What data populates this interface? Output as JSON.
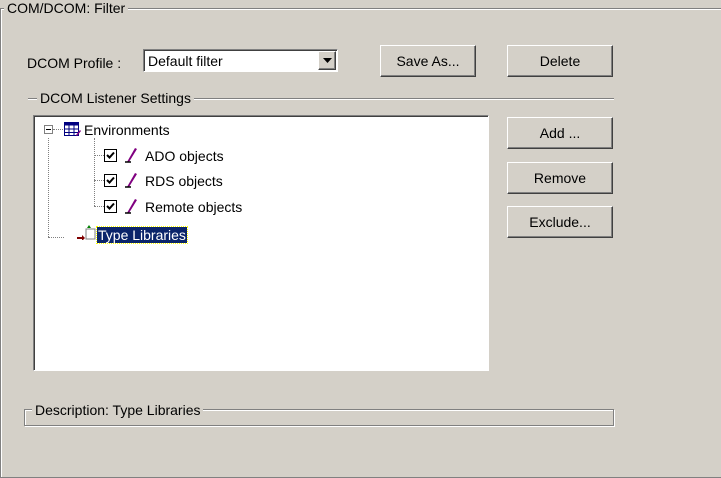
{
  "filter_group": {
    "title": "COM/DCOM: Filter"
  },
  "profile": {
    "label": "DCOM Profile :",
    "selected": "Default filter"
  },
  "buttons": {
    "save_as": "Save As...",
    "delete": "Delete",
    "add": "Add ...",
    "remove": "Remove",
    "exclude": "Exclude..."
  },
  "listener": {
    "title": "DCOM Listener Settings"
  },
  "tree": {
    "root": {
      "label": "Environments",
      "icon": "environments-table-icon",
      "expanded": true
    },
    "children": [
      {
        "label": "ADO objects",
        "checked": true,
        "icon": "pen-icon"
      },
      {
        "label": "RDS objects",
        "checked": true,
        "icon": "pen-icon"
      },
      {
        "label": "Remote objects",
        "checked": true,
        "icon": "pen-icon"
      }
    ],
    "type_libraries": {
      "label": "Type Libraries",
      "icon": "type-library-icon",
      "selected": true
    }
  },
  "description": {
    "title": "Description: Type Libraries"
  }
}
